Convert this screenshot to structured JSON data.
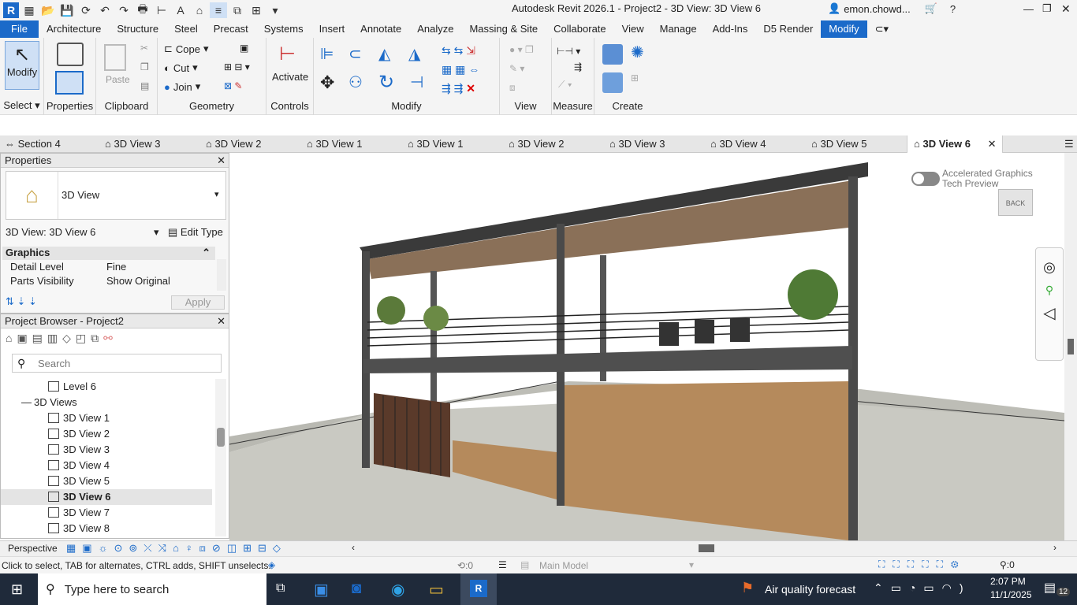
{
  "app": {
    "title": "Autodesk Revit 2026.1 - Project2 - 3D View: 3D View 6",
    "user": "emon.chowd..."
  },
  "ribbon_tabs": [
    "File",
    "Architecture",
    "Structure",
    "Steel",
    "Precast",
    "Systems",
    "Insert",
    "Annotate",
    "Analyze",
    "Massing & Site",
    "Collaborate",
    "View",
    "Manage",
    "Add-Ins",
    "D5 Render",
    "Modify"
  ],
  "active_tab": "Modify",
  "ribbon": {
    "select": {
      "btn": "Modify",
      "panel": "Select"
    },
    "properties": {
      "panel": "Properties"
    },
    "clipboard": {
      "paste": "Paste",
      "panel": "Clipboard"
    },
    "geometry": {
      "cope": "Cope",
      "cut": "Cut",
      "join": "Join",
      "panel": "Geometry"
    },
    "controls": {
      "activate": "Activate",
      "panel": "Controls"
    },
    "modify": {
      "panel": "Modify"
    },
    "view": {
      "panel": "View"
    },
    "measure": {
      "panel": "Measure"
    },
    "create": {
      "panel": "Create"
    }
  },
  "view_tabs": [
    "Section 4",
    "3D View 3",
    "3D View 2",
    "3D View 1",
    "3D View 1",
    "3D View 2",
    "3D View 3",
    "3D View 4",
    "3D View 5",
    "3D View 6"
  ],
  "properties": {
    "title": "Properties",
    "type_name": "3D View",
    "selector": "3D View: 3D View 6",
    "edit_type": "Edit Type",
    "group": "Graphics",
    "rows": [
      {
        "k": "Detail Level",
        "v": "Fine"
      },
      {
        "k": "Parts Visibility",
        "v": "Show Original"
      }
    ],
    "apply": "Apply"
  },
  "browser": {
    "title": "Project Browser - Project2",
    "search_placeholder": "Search",
    "items": [
      "Level 6",
      "3D Views",
      "3D View 1",
      "3D View 2",
      "3D View 3",
      "3D View 4",
      "3D View 5",
      "3D View 6",
      "3D View 7",
      "3D View 8"
    ]
  },
  "viewport": {
    "accel": "Accelerated Graphics",
    "tech": "Tech Preview",
    "cube": "BACK"
  },
  "view_control": {
    "mode": "Perspective"
  },
  "status": {
    "hint": "Click to select, TAB for alternates, CTRL adds, SHIFT unselects.",
    "count": ":0",
    "model": "Main Model",
    "filter": ":0"
  },
  "taskbar": {
    "search": "Type here to search",
    "weather": "Air quality forecast",
    "time": "2:07 PM",
    "date": "11/1/2025",
    "notif": "12"
  }
}
